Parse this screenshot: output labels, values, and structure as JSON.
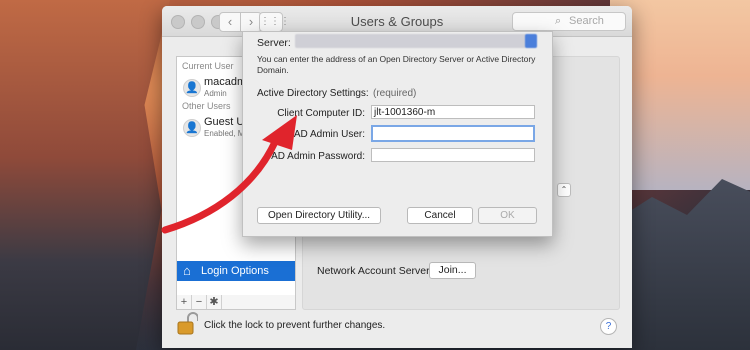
{
  "window": {
    "title": "Users & Groups"
  },
  "search": {
    "placeholder": "Search"
  },
  "sidebar": {
    "current_user_header": "Current User",
    "current_user": {
      "name": "macadmin",
      "role": "Admin"
    },
    "other_users_header": "Other Users",
    "guest_user": {
      "name": "Guest Us",
      "status": "Enabled, M"
    },
    "login_options_label": "Login Options",
    "tools": {
      "add": "+",
      "remove": "−",
      "gear": "✱"
    }
  },
  "pane": {
    "network_account_server_label": "Network Account Server:",
    "join_button": "Join..."
  },
  "bottom": {
    "lock_text": "Click the lock to prevent further changes.",
    "help": "?"
  },
  "sheet": {
    "server_label": "Server:",
    "description": "You can enter the address of an Open Directory Server or Active Directory Domain.",
    "ads_label": "Active Directory Settings:",
    "required_label": "(required)",
    "fields": {
      "client_computer_id_label": "Client Computer ID:",
      "client_computer_id_value": "jlt-1001360-m",
      "ad_admin_user_label": "AD Admin User:",
      "ad_admin_user_value": "",
      "ad_admin_password_label": "AD Admin Password:",
      "ad_admin_password_value": ""
    },
    "buttons": {
      "open_directory_utility": "Open Directory Utility...",
      "cancel": "Cancel",
      "ok": "OK"
    }
  },
  "colors": {
    "accent": "#1a6fd4",
    "arrow": "#e0242c"
  }
}
